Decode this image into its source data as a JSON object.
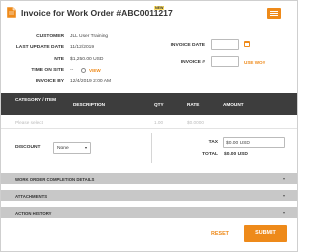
{
  "header": {
    "title": "Invoice for Work Order #ABC0011217",
    "badge": "NEW",
    "icon": "document-icon",
    "menu_icon": "hamburger-menu-icon",
    "accent": "#ee8a1a"
  },
  "info": {
    "customer_label": "CUSTOMER",
    "customer_value": "JLL User Training",
    "last_update_label": "LAST UPDATE DATE",
    "last_update_value": "11/12/2019",
    "nte_label": "NTE",
    "nte_value": "$1,250.00 USD",
    "time_on_site_label": "TIME ON SITE",
    "time_on_site_value": "--",
    "view_link": "VIEW",
    "invoice_by_label": "INVOICE BY",
    "invoice_by_value": "12/4/2019 2:00 AM"
  },
  "invoice_fields": {
    "date_label": "INVOICE DATE",
    "date_value": "",
    "number_label": "INVOICE #",
    "number_value": "",
    "use_wo_link": "USE WO#"
  },
  "table": {
    "columns": [
      "CATEGORY / ITEM",
      "DESCRIPTION",
      "QTY",
      "RATE",
      "AMOUNT"
    ],
    "placeholder_row": {
      "item": "Please select",
      "qty": "1.00",
      "rate": "$0.0000"
    }
  },
  "totals": {
    "discount_label": "DISCOUNT",
    "discount_value": "None",
    "tax_label": "TAX",
    "tax_value": "$0.00 USD",
    "total_label": "TOTAL",
    "total_value": "$0.00 USD"
  },
  "sections": [
    {
      "label": "WORK ORDER COMPLETION DETAILS"
    },
    {
      "label": "ATTACHMENTS"
    },
    {
      "label": "ACTION HISTORY"
    }
  ],
  "footer": {
    "reset_label": "RESET",
    "submit_label": "SUBMIT"
  }
}
